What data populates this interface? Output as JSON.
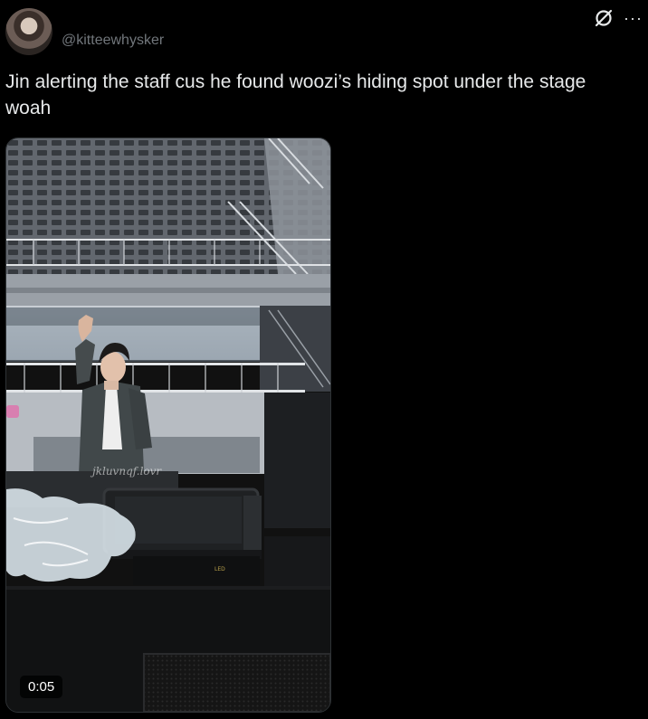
{
  "post": {
    "handle": "@kitteewhysker",
    "text": "Jin alerting the staff cus he found woozi’s hiding spot under the stage woah"
  },
  "icons": {
    "grok": "grok-slash-icon",
    "more": "more-horizontal-icon",
    "more_glyph": "···"
  },
  "video": {
    "duration": "0:05",
    "watermark": "jkluvnqf.lovr"
  },
  "colors": {
    "background": "#000000",
    "text": "#e7e9ea",
    "muted": "#71767b"
  }
}
